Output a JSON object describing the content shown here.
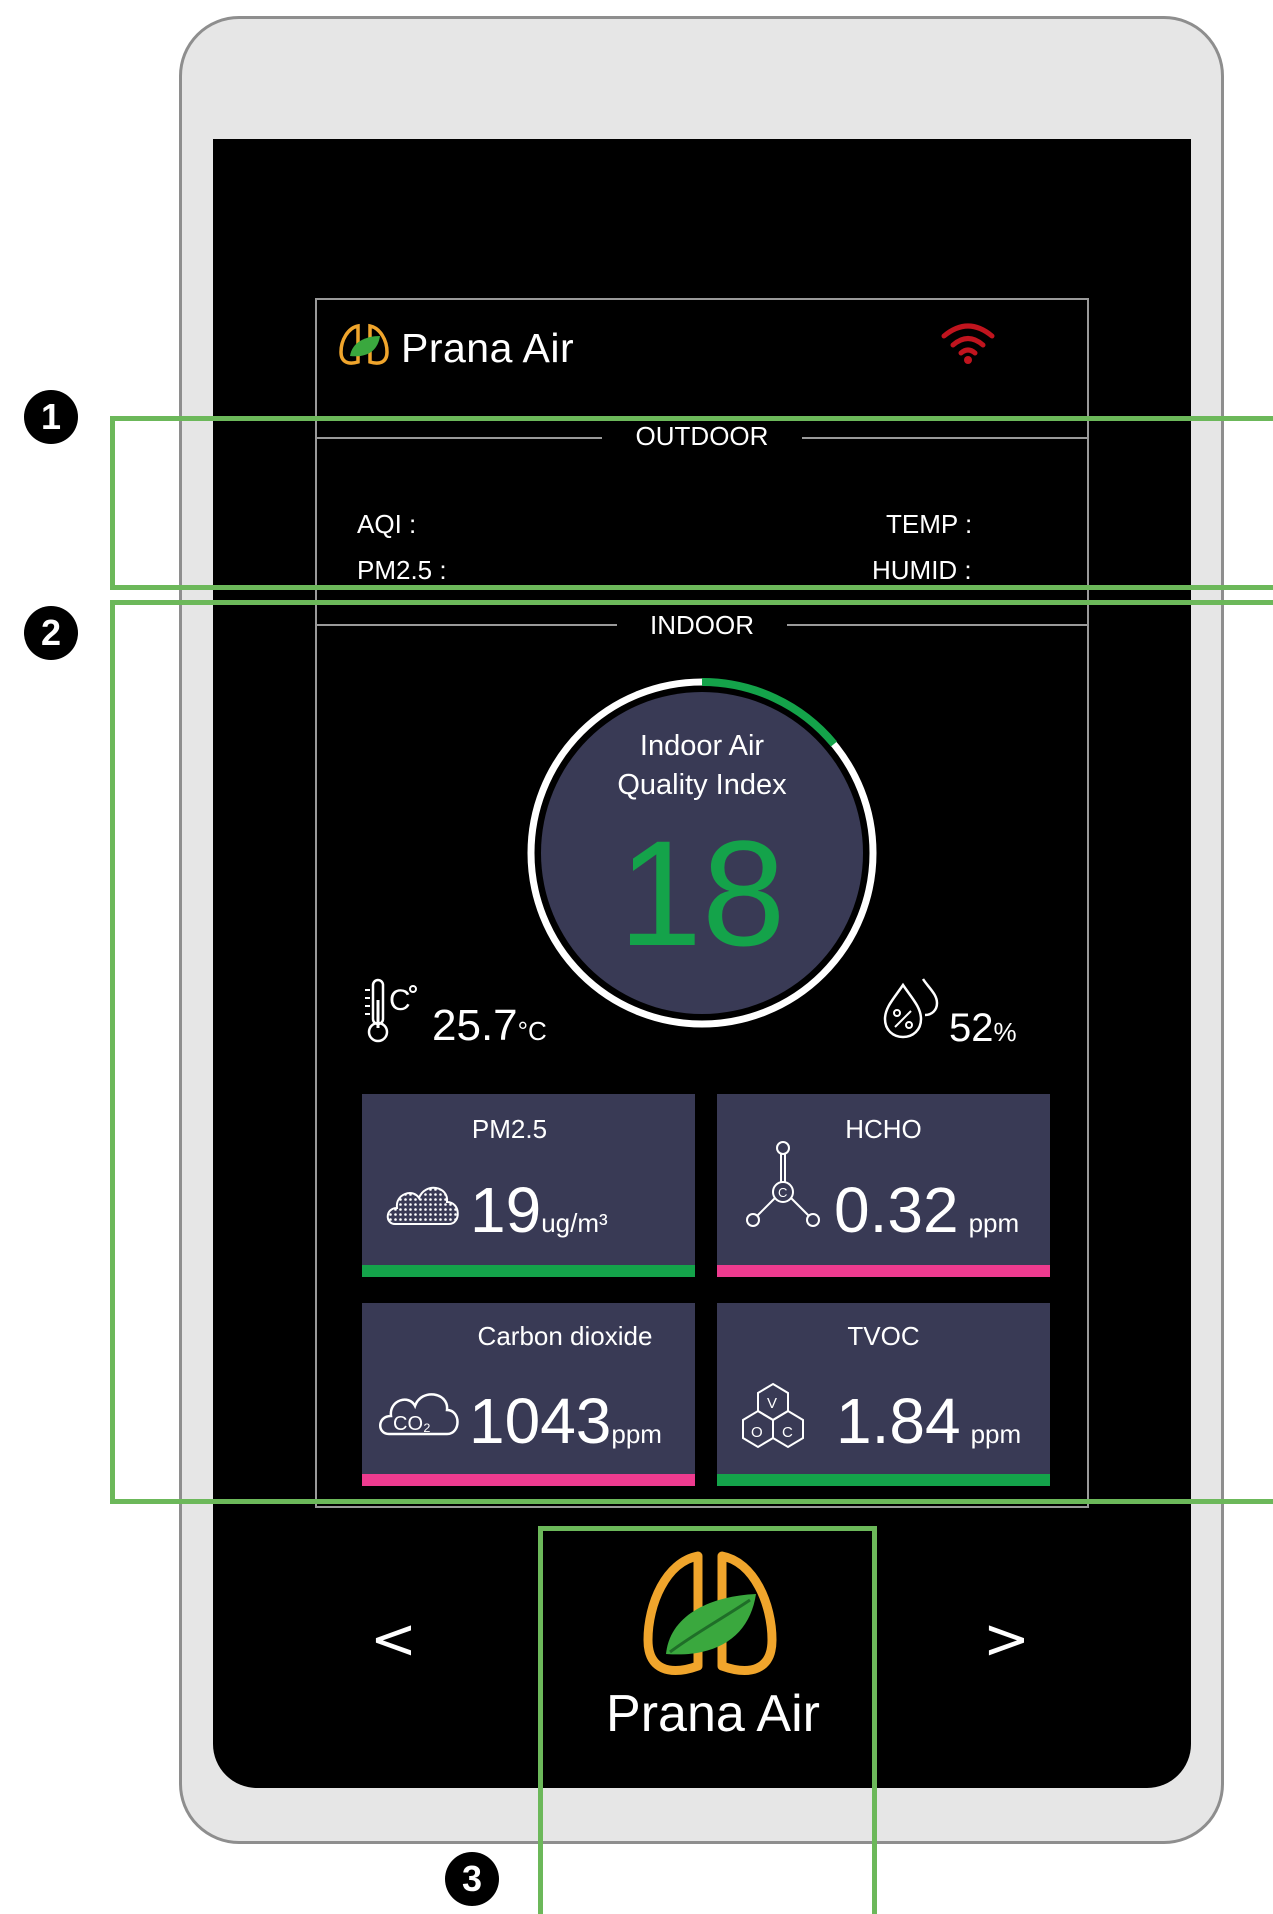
{
  "brand": {
    "name": "Prana Air",
    "logo_name": "Prana Air",
    "accent_green": "#14a34a",
    "accent_orange": "#f0a52c"
  },
  "status": {
    "wifi_color": "#c0141e"
  },
  "outdoor": {
    "title": "OUTDOOR",
    "aqi_label": "AQI :",
    "pm25_label": "PM2.5 :",
    "temp_label": "TEMP :",
    "humid_label": "HUMID :"
  },
  "indoor": {
    "title": "INDOOR",
    "gauge_title_line1": "Indoor Air",
    "gauge_title_line2": "Quality Index",
    "aqi_value": "18",
    "temperature": {
      "value": "25.7",
      "unit": "°C"
    },
    "humidity": {
      "value": "52",
      "unit": "%"
    },
    "cards": [
      {
        "title": "PM2.5",
        "value": "19",
        "unit": "ug/m³",
        "status_color": "#14a34a",
        "icon": "cloud-dots-icon"
      },
      {
        "title": "HCHO",
        "value": "0.32",
        "unit": "ppm",
        "status_color": "#ee3b8f",
        "icon": "formaldehyde-molecule-icon"
      },
      {
        "title": "Carbon dioxide",
        "value": "1043",
        "unit": "ppm",
        "status_color": "#ee3b8f",
        "icon": "co2-cloud-icon"
      },
      {
        "title": "TVOC",
        "value": "1.84",
        "unit": "ppm",
        "status_color": "#14a34a",
        "icon": "voc-molecule-icon"
      }
    ]
  },
  "nav": {
    "prev": "<",
    "next": ">"
  },
  "callouts": {
    "one": "1",
    "two": "2",
    "three": "3"
  }
}
